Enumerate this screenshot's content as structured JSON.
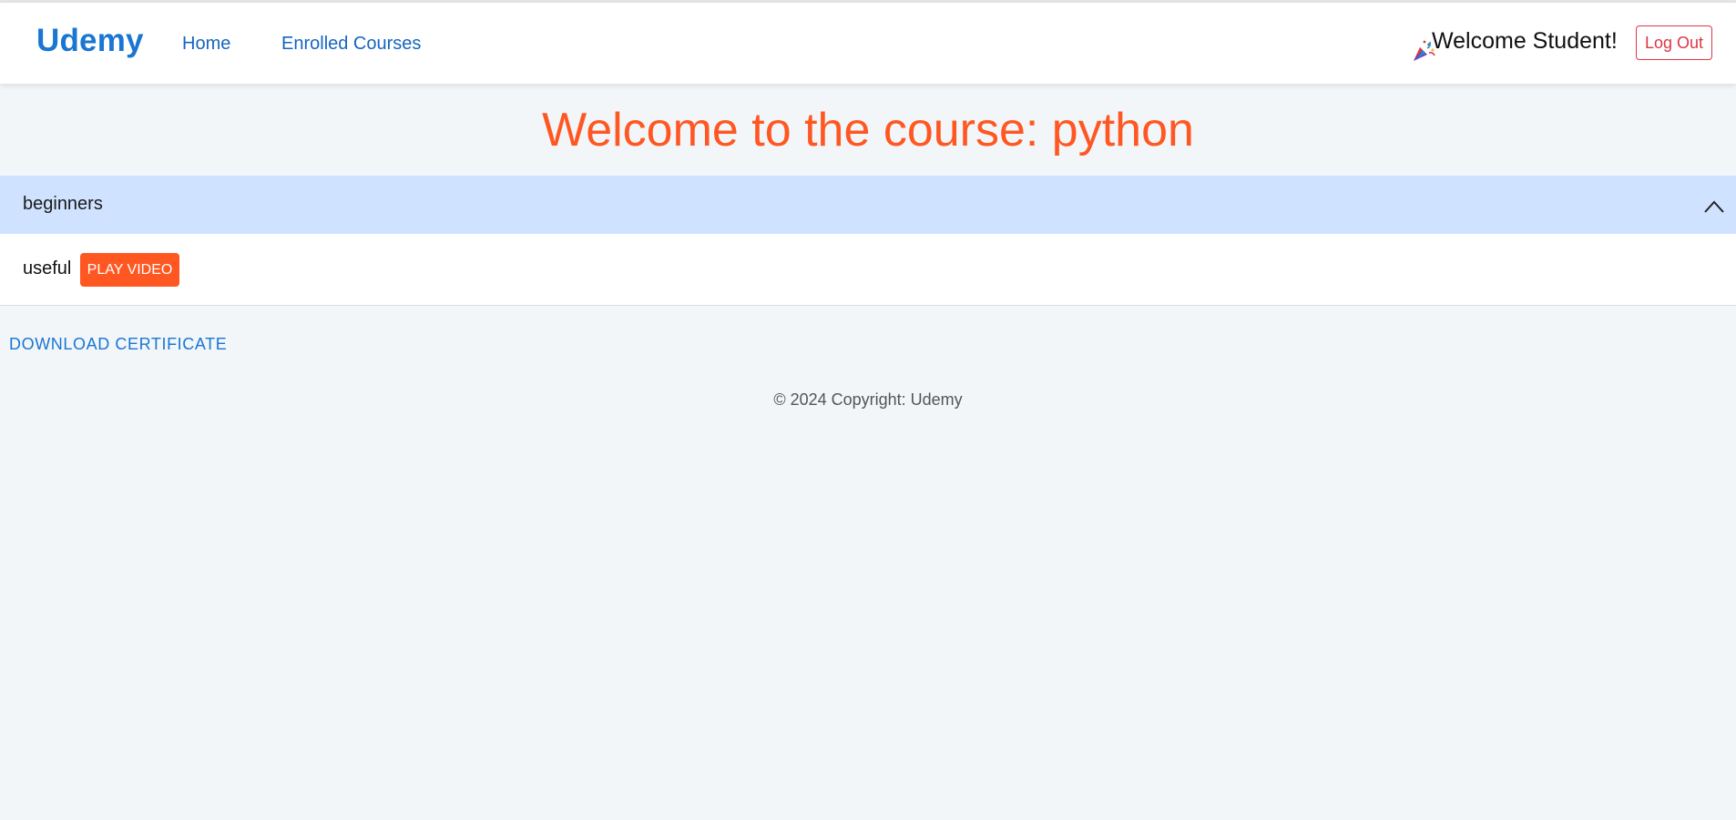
{
  "navbar": {
    "brand": "Udemy",
    "links": [
      {
        "label": "Home"
      },
      {
        "label": "Enrolled Courses"
      }
    ],
    "welcome": "Welcome Student!",
    "logout_label": "Log Out"
  },
  "course": {
    "title": "Welcome to the course: python",
    "sections": [
      {
        "name": "beginners",
        "expanded": true,
        "lessons": [
          {
            "name": "useful",
            "action_label": "PLAY VIDEO"
          }
        ]
      }
    ]
  },
  "download_label": "DOWNLOAD CERTIFICATE",
  "footer": "© 2024 Copyright: Udemy",
  "colors": {
    "brand": "#1976d2",
    "accent": "#ff5722",
    "danger": "#dc3545",
    "accordion_header": "#cfe2ff",
    "page_background": "#f2f6f9"
  },
  "icons": {
    "welcome": "party-popper-icon",
    "accordion_toggle": "chevron-up-icon"
  }
}
